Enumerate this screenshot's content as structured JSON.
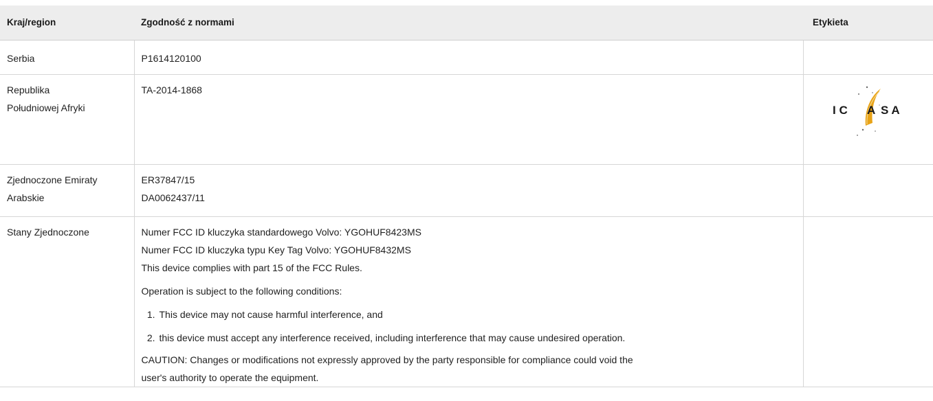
{
  "table": {
    "headers": {
      "country": "Kraj/region",
      "compliance": "Zgodność z normami",
      "label": "Etykieta"
    },
    "rows": [
      {
        "country": "Serbia",
        "compliance_lines": [
          "P1614120100"
        ]
      },
      {
        "country_lines": [
          "Republika",
          "Południowej Afryki"
        ],
        "compliance_lines": [
          "TA-2014-1868"
        ],
        "label_logo": {
          "text_left": "I C",
          "text_center": "A",
          "text_right": "S A",
          "logo_icon": "icasa-logo",
          "arc_color": "#e8a317"
        }
      },
      {
        "country_lines": [
          "Zjednoczone Emiraty",
          "Arabskie"
        ],
        "compliance_lines": [
          "ER37847/15",
          "DA0062437/11"
        ]
      },
      {
        "country": "Stany Zjednoczone",
        "compliance_lines": [
          "Numer FCC ID kluczyka standardowego Volvo: YGOHUF8423MS",
          "Numer FCC ID kluczyka typu Key Tag Volvo: YGOHUF8432MS",
          "This device complies with part 15 of the FCC Rules."
        ],
        "conditions_intro": "Operation is subject to the following conditions:",
        "conditions": [
          {
            "num": "1.",
            "text": "This device may not cause harmful interference, and"
          },
          {
            "num": "2.",
            "text": "this device must accept any interference received, including interference that may cause undesired operation."
          }
        ],
        "caution_lines": [
          "CAUTION: Changes or modifications not expressly approved by the party responsible for compliance could void the",
          "user's authority to operate the equipment."
        ]
      }
    ]
  }
}
